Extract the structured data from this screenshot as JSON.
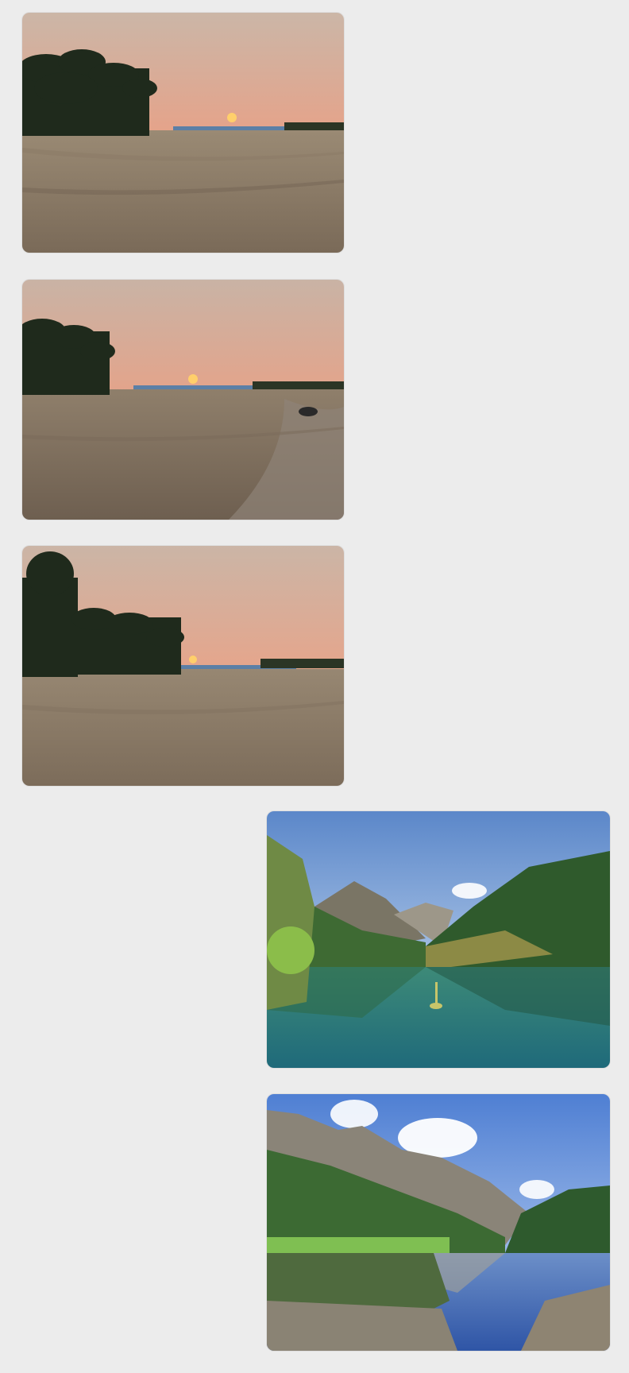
{
  "chat": {
    "messages": [
      {
        "sender": "contact",
        "type": "image",
        "icon": "photo-sunset-beach"
      },
      {
        "sender": "contact",
        "type": "image",
        "icon": "photo-sunset-beach"
      },
      {
        "sender": "contact",
        "type": "image",
        "icon": "photo-sunset-beach"
      },
      {
        "sender": "self",
        "type": "image",
        "icon": "photo-mountain-lake"
      },
      {
        "sender": "self",
        "type": "image",
        "icon": "photo-mountain-lake"
      }
    ]
  },
  "colors": {
    "background": "#ececec",
    "sunset_sky_top": "#cdb4a4",
    "sunset_sky_horizon": "#e2a58c",
    "sun": "#ffb347",
    "sand": "#8a7a68",
    "lake_sky": "#6d97d6",
    "lake_water": "#2f7f7e",
    "forest": "#3f6b35"
  }
}
